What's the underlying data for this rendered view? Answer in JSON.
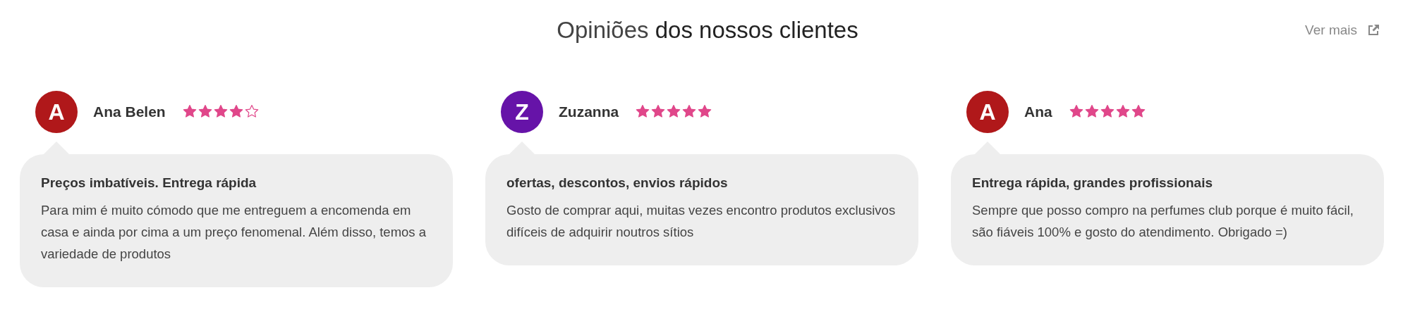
{
  "header": {
    "title": "Opiniões **dos nossos clientes**",
    "link": "Ver mais"
  },
  "reviews": [
    {
      "initial": "A",
      "color": "#b0181a",
      "name": "Ana Belen",
      "stars": 4,
      "headline": "Preços imbatíveis. Entrega rápida",
      "text": "Para mim é muito cómodo que me entreguem a encomenda em casa e ainda por cima a um preço fenomenal. Além disso, temos a variedade de produtos"
    },
    {
      "initial": "Z",
      "color": "#6613a8",
      "name": "Zuzanna",
      "stars": 5,
      "headline": "ofertas, descontos, envios rápidos",
      "text": "Gosto de comprar aqui, muitas vezes encontro produtos exclusivos difíceis de adquirir noutros sítios"
    },
    {
      "initial": "A",
      "color": "#b0181a",
      "name": "Ana",
      "stars": 5,
      "headline": "Entrega rápida, grandes profissionais",
      "text": "Sempre que posso compro na perfumes club porque é muito fácil, são fiáveis 100% e gosto do atendimento. Obrigado =)"
    }
  ]
}
